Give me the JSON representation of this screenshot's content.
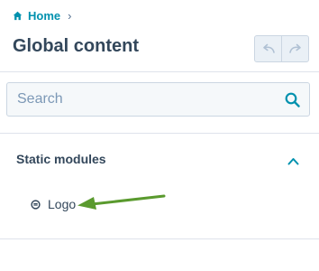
{
  "breadcrumb": {
    "home_label": "Home",
    "separator": "›"
  },
  "page": {
    "title": "Global content"
  },
  "toolbar": {
    "undo_icon": "undo-icon",
    "redo_icon": "redo-icon"
  },
  "search": {
    "placeholder": "Search",
    "value": ""
  },
  "sections": [
    {
      "label": "Static modules",
      "expanded": true,
      "items": [
        {
          "label": "Logo",
          "icon": "module-icon"
        }
      ]
    }
  ],
  "annotation": {
    "arrow_color": "#5a9a2e"
  },
  "colors": {
    "accent": "#0091ae",
    "text": "#33475b",
    "border": "#cbd6e2",
    "input_bg": "#f5f8fa"
  }
}
